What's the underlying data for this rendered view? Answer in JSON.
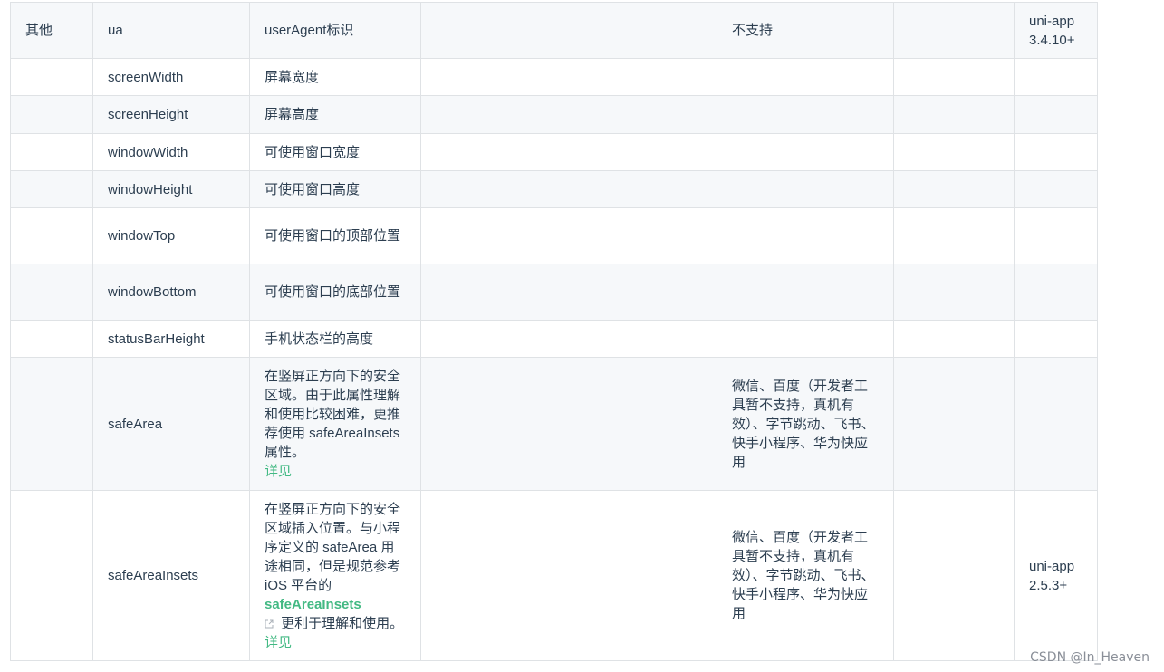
{
  "table": {
    "rows": [
      {
        "c0": "其他",
        "c1": "ua",
        "c2": "userAgent标识",
        "c5": "不支持",
        "c7": "uni-app 3.4.10+"
      },
      {
        "c1": "screenWidth",
        "c2": "屏幕宽度"
      },
      {
        "c1": "screenHeight",
        "c2": "屏幕高度"
      },
      {
        "c1": "windowWidth",
        "c2": "可使用窗口宽度"
      },
      {
        "c1": "windowHeight",
        "c2": "可使用窗口高度"
      },
      {
        "c1": "windowTop",
        "c2": "可使用窗口的顶部位置"
      },
      {
        "c1": "windowBottom",
        "c2": "可使用窗口的底部位置"
      },
      {
        "c1": "statusBarHeight",
        "c2": "手机状态栏的高度"
      },
      {
        "c1": "safeArea",
        "c2_text": "在竖屏正方向下的安全区域。由于此属性理解和使用比较困难，更推荐使用 safeAreaInsets 属性。",
        "c2_link": "详见",
        "c5": "微信、百度（开发者工具暂不支持，真机有效）、字节跳动、飞书、快手小程序、华为快应用"
      },
      {
        "c1": "safeAreaInsets",
        "c2_text_a": "在竖屏正方向下的安全区域插入位置。与小程序定义的 safeArea 用途相同，但是规范参考 iOS 平台的 ",
        "c2_strong": "safeAreaInsets",
        "c2_text_b": " 更利于理解和使用。",
        "c2_link": "详见",
        "c5": "微信、百度（开发者工具暂不支持，真机有效）、字节跳动、飞书、快手小程序、华为快应用",
        "c7": "uni-app 2.5.3+"
      }
    ]
  },
  "watermark": "CSDN @In_Heaven",
  "colors": {
    "link": "#42b983",
    "row_alt": "#f6f8fa",
    "border": "#dfe2e5",
    "text": "#2c3e50"
  },
  "icons": {
    "external_link": "external-link-icon"
  }
}
